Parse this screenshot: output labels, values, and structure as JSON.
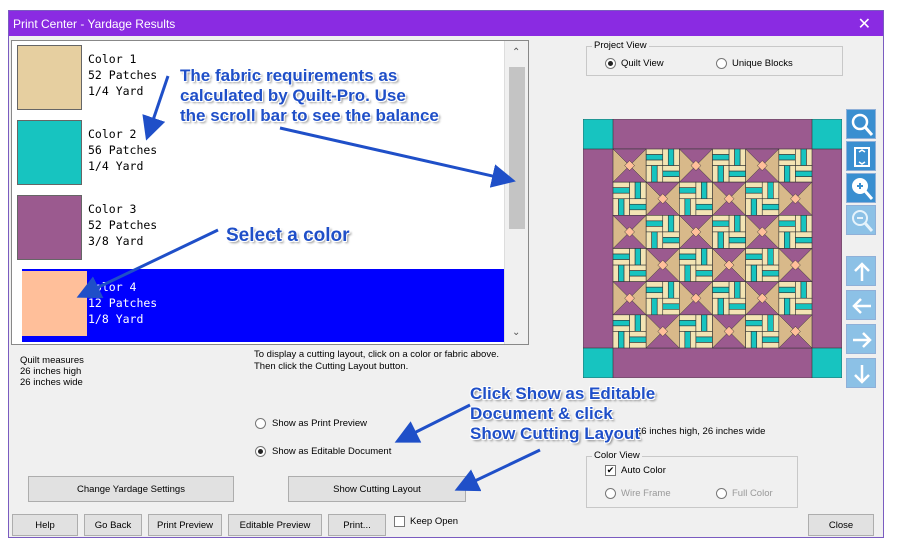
{
  "window": {
    "title": "Print Center - Yardage Results",
    "close_glyph": "✕"
  },
  "colors": [
    {
      "name": "Color 1",
      "patches": "52 Patches",
      "yardage": "1/4 Yard",
      "swatch": "#e6cfa0"
    },
    {
      "name": "Color 2",
      "patches": "56 Patches",
      "yardage": "1/4 Yard",
      "swatch": "#17c4c0"
    },
    {
      "name": "Color 3",
      "patches": "52 Patches",
      "yardage": "3/8 Yard",
      "swatch": "#9b5a8f"
    },
    {
      "name": "Color 4",
      "patches": "12 Patches",
      "yardage": "1/8 Yard",
      "swatch": "#ffbf9a"
    }
  ],
  "selected_color": "Color 4",
  "quilt_measures": {
    "line1": "Quilt measures",
    "line2": "26 inches high",
    "line3": "26 inches wide"
  },
  "instructions": {
    "line1": "To display a cutting layout, click on a color or fabric above.",
    "line2": "Then click the Cutting Layout button."
  },
  "output_options": {
    "print_preview": "Show as Print Preview",
    "editable_document": "Show as Editable Document",
    "selected": "editable_document"
  },
  "buttons": {
    "change_yardage": "Change Yardage Settings",
    "show_cutting_layout": "Show Cutting Layout",
    "help": "Help",
    "go_back": "Go Back",
    "print_preview": "Print Preview",
    "editable_preview": "Editable Preview",
    "print": "Print...",
    "keep_open": "Keep Open",
    "close": "Close"
  },
  "project_view": {
    "label": "Project View",
    "quilt_view": "Quilt View",
    "unique_blocks": "Unique Blocks",
    "selected": "quilt_view"
  },
  "quilt_size_text": "26 inches high, 26 inches wide",
  "color_view": {
    "label": "Color View",
    "auto_color": "Auto Color",
    "auto_checked": true,
    "wire_frame": "Wire Frame",
    "full_color": "Full Color"
  },
  "quilt_colors": {
    "border": "#9b5a8f",
    "corner": "#17c4c0",
    "tan": "#d8b98a",
    "cream": "#f3e4b4",
    "teal": "#17c4c0",
    "purple": "#9b5a8f",
    "peach": "#ffbf9a"
  },
  "toolbar_icons": [
    "zoom-icon",
    "fit-page-icon",
    "zoom-in-icon",
    "zoom-out-icon",
    "arrow-up-icon",
    "arrow-left-icon",
    "arrow-right-icon",
    "arrow-down-icon"
  ],
  "annotations": {
    "fabric_line1": "The fabric requirements as",
    "fabric_line2": "calculated by Quilt-Pro. Use",
    "fabric_line3": "the scroll bar to see the balance",
    "select": "Select a color",
    "click_line1": "Click Show as Editable",
    "click_line2": "Document & click",
    "click_line3": "Show Cutting Layout",
    "color": "#1f4fc8"
  }
}
